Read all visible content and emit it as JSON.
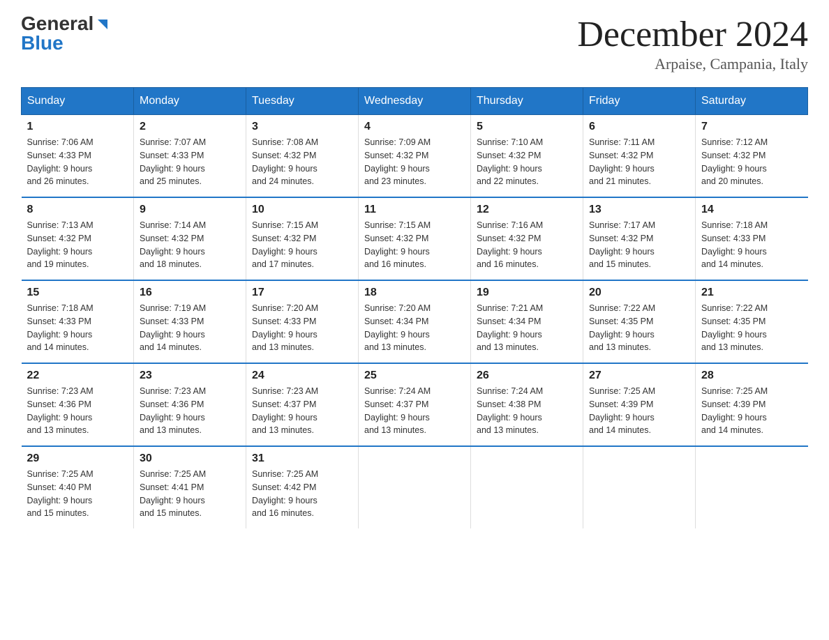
{
  "header": {
    "logo_general": "General",
    "logo_blue": "Blue",
    "month_title": "December 2024",
    "location": "Arpaise, Campania, Italy"
  },
  "days_of_week": [
    "Sunday",
    "Monday",
    "Tuesday",
    "Wednesday",
    "Thursday",
    "Friday",
    "Saturday"
  ],
  "weeks": [
    [
      {
        "num": "1",
        "sunrise": "7:06 AM",
        "sunset": "4:33 PM",
        "daylight": "9 hours and 26 minutes."
      },
      {
        "num": "2",
        "sunrise": "7:07 AM",
        "sunset": "4:33 PM",
        "daylight": "9 hours and 25 minutes."
      },
      {
        "num": "3",
        "sunrise": "7:08 AM",
        "sunset": "4:32 PM",
        "daylight": "9 hours and 24 minutes."
      },
      {
        "num": "4",
        "sunrise": "7:09 AM",
        "sunset": "4:32 PM",
        "daylight": "9 hours and 23 minutes."
      },
      {
        "num": "5",
        "sunrise": "7:10 AM",
        "sunset": "4:32 PM",
        "daylight": "9 hours and 22 minutes."
      },
      {
        "num": "6",
        "sunrise": "7:11 AM",
        "sunset": "4:32 PM",
        "daylight": "9 hours and 21 minutes."
      },
      {
        "num": "7",
        "sunrise": "7:12 AM",
        "sunset": "4:32 PM",
        "daylight": "9 hours and 20 minutes."
      }
    ],
    [
      {
        "num": "8",
        "sunrise": "7:13 AM",
        "sunset": "4:32 PM",
        "daylight": "9 hours and 19 minutes."
      },
      {
        "num": "9",
        "sunrise": "7:14 AM",
        "sunset": "4:32 PM",
        "daylight": "9 hours and 18 minutes."
      },
      {
        "num": "10",
        "sunrise": "7:15 AM",
        "sunset": "4:32 PM",
        "daylight": "9 hours and 17 minutes."
      },
      {
        "num": "11",
        "sunrise": "7:15 AM",
        "sunset": "4:32 PM",
        "daylight": "9 hours and 16 minutes."
      },
      {
        "num": "12",
        "sunrise": "7:16 AM",
        "sunset": "4:32 PM",
        "daylight": "9 hours and 16 minutes."
      },
      {
        "num": "13",
        "sunrise": "7:17 AM",
        "sunset": "4:32 PM",
        "daylight": "9 hours and 15 minutes."
      },
      {
        "num": "14",
        "sunrise": "7:18 AM",
        "sunset": "4:33 PM",
        "daylight": "9 hours and 14 minutes."
      }
    ],
    [
      {
        "num": "15",
        "sunrise": "7:18 AM",
        "sunset": "4:33 PM",
        "daylight": "9 hours and 14 minutes."
      },
      {
        "num": "16",
        "sunrise": "7:19 AM",
        "sunset": "4:33 PM",
        "daylight": "9 hours and 14 minutes."
      },
      {
        "num": "17",
        "sunrise": "7:20 AM",
        "sunset": "4:33 PM",
        "daylight": "9 hours and 13 minutes."
      },
      {
        "num": "18",
        "sunrise": "7:20 AM",
        "sunset": "4:34 PM",
        "daylight": "9 hours and 13 minutes."
      },
      {
        "num": "19",
        "sunrise": "7:21 AM",
        "sunset": "4:34 PM",
        "daylight": "9 hours and 13 minutes."
      },
      {
        "num": "20",
        "sunrise": "7:22 AM",
        "sunset": "4:35 PM",
        "daylight": "9 hours and 13 minutes."
      },
      {
        "num": "21",
        "sunrise": "7:22 AM",
        "sunset": "4:35 PM",
        "daylight": "9 hours and 13 minutes."
      }
    ],
    [
      {
        "num": "22",
        "sunrise": "7:23 AM",
        "sunset": "4:36 PM",
        "daylight": "9 hours and 13 minutes."
      },
      {
        "num": "23",
        "sunrise": "7:23 AM",
        "sunset": "4:36 PM",
        "daylight": "9 hours and 13 minutes."
      },
      {
        "num": "24",
        "sunrise": "7:23 AM",
        "sunset": "4:37 PM",
        "daylight": "9 hours and 13 minutes."
      },
      {
        "num": "25",
        "sunrise": "7:24 AM",
        "sunset": "4:37 PM",
        "daylight": "9 hours and 13 minutes."
      },
      {
        "num": "26",
        "sunrise": "7:24 AM",
        "sunset": "4:38 PM",
        "daylight": "9 hours and 13 minutes."
      },
      {
        "num": "27",
        "sunrise": "7:25 AM",
        "sunset": "4:39 PM",
        "daylight": "9 hours and 14 minutes."
      },
      {
        "num": "28",
        "sunrise": "7:25 AM",
        "sunset": "4:39 PM",
        "daylight": "9 hours and 14 minutes."
      }
    ],
    [
      {
        "num": "29",
        "sunrise": "7:25 AM",
        "sunset": "4:40 PM",
        "daylight": "9 hours and 15 minutes."
      },
      {
        "num": "30",
        "sunrise": "7:25 AM",
        "sunset": "4:41 PM",
        "daylight": "9 hours and 15 minutes."
      },
      {
        "num": "31",
        "sunrise": "7:25 AM",
        "sunset": "4:42 PM",
        "daylight": "9 hours and 16 minutes."
      },
      null,
      null,
      null,
      null
    ]
  ],
  "labels": {
    "sunrise": "Sunrise:",
    "sunset": "Sunset:",
    "daylight": "Daylight:"
  }
}
